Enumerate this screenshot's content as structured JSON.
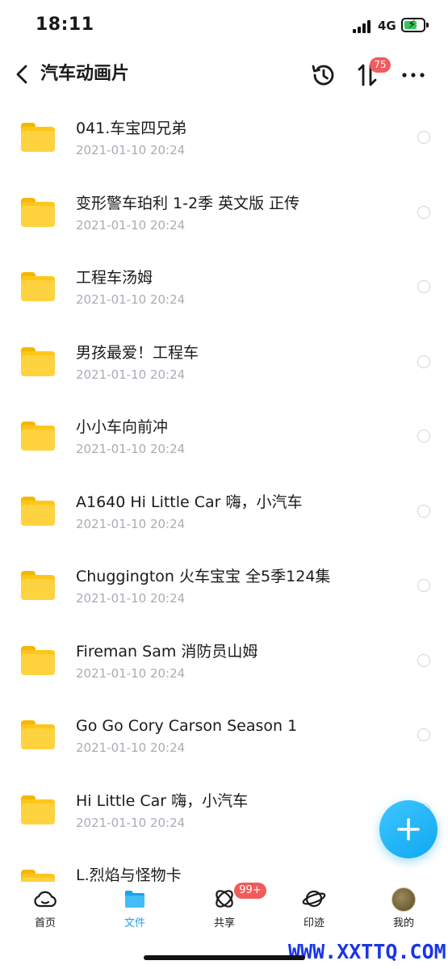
{
  "status_bar": {
    "time": "18:11",
    "network": "4G"
  },
  "nav": {
    "title": "汽车动画片",
    "sort_badge": "75",
    "icons": [
      "back-icon",
      "history-icon",
      "sort-icon",
      "more-icon"
    ]
  },
  "files": [
    {
      "name": "041.车宝四兄弟",
      "date": "2021-01-10 20:24"
    },
    {
      "name": "变形警车珀利 1-2季 英文版 正传",
      "date": "2021-01-10 20:24"
    },
    {
      "name": "工程车汤姆",
      "date": "2021-01-10 20:24"
    },
    {
      "name": "男孩最爱！工程车",
      "date": "2021-01-10 20:24"
    },
    {
      "name": "小小车向前冲",
      "date": "2021-01-10 20:24"
    },
    {
      "name": "A1640 Hi Little Car 嗨，小汽车",
      "date": "2021-01-10 20:24"
    },
    {
      "name": "Chuggington 火车宝宝 全5季124集",
      "date": "2021-01-10 20:24"
    },
    {
      "name": "Fireman Sam 消防员山姆",
      "date": "2021-01-10 20:24"
    },
    {
      "name": "Go Go Cory Carson Season 1",
      "date": "2021-01-10 20:24"
    },
    {
      "name": "Hi Little Car 嗨，小汽车",
      "date": "2021-01-10 20:24"
    },
    {
      "name": "L.烈焰与怪物卡",
      "date": ""
    }
  ],
  "tabs": [
    {
      "label": "首页",
      "icon": "home-cloud-icon"
    },
    {
      "label": "文件",
      "icon": "folder-icon",
      "active": true
    },
    {
      "label": "共享",
      "icon": "share-orbit-icon",
      "badge": "99+"
    },
    {
      "label": "印迹",
      "icon": "planet-icon"
    },
    {
      "label": "我的",
      "icon": "avatar"
    }
  ],
  "colors": {
    "accent": "#1aa3f0",
    "badge": "#f25b5b",
    "folder": "#ffc61a",
    "date_text": "#a8adb5"
  },
  "watermark": "WWW.XXTTQ.COM"
}
